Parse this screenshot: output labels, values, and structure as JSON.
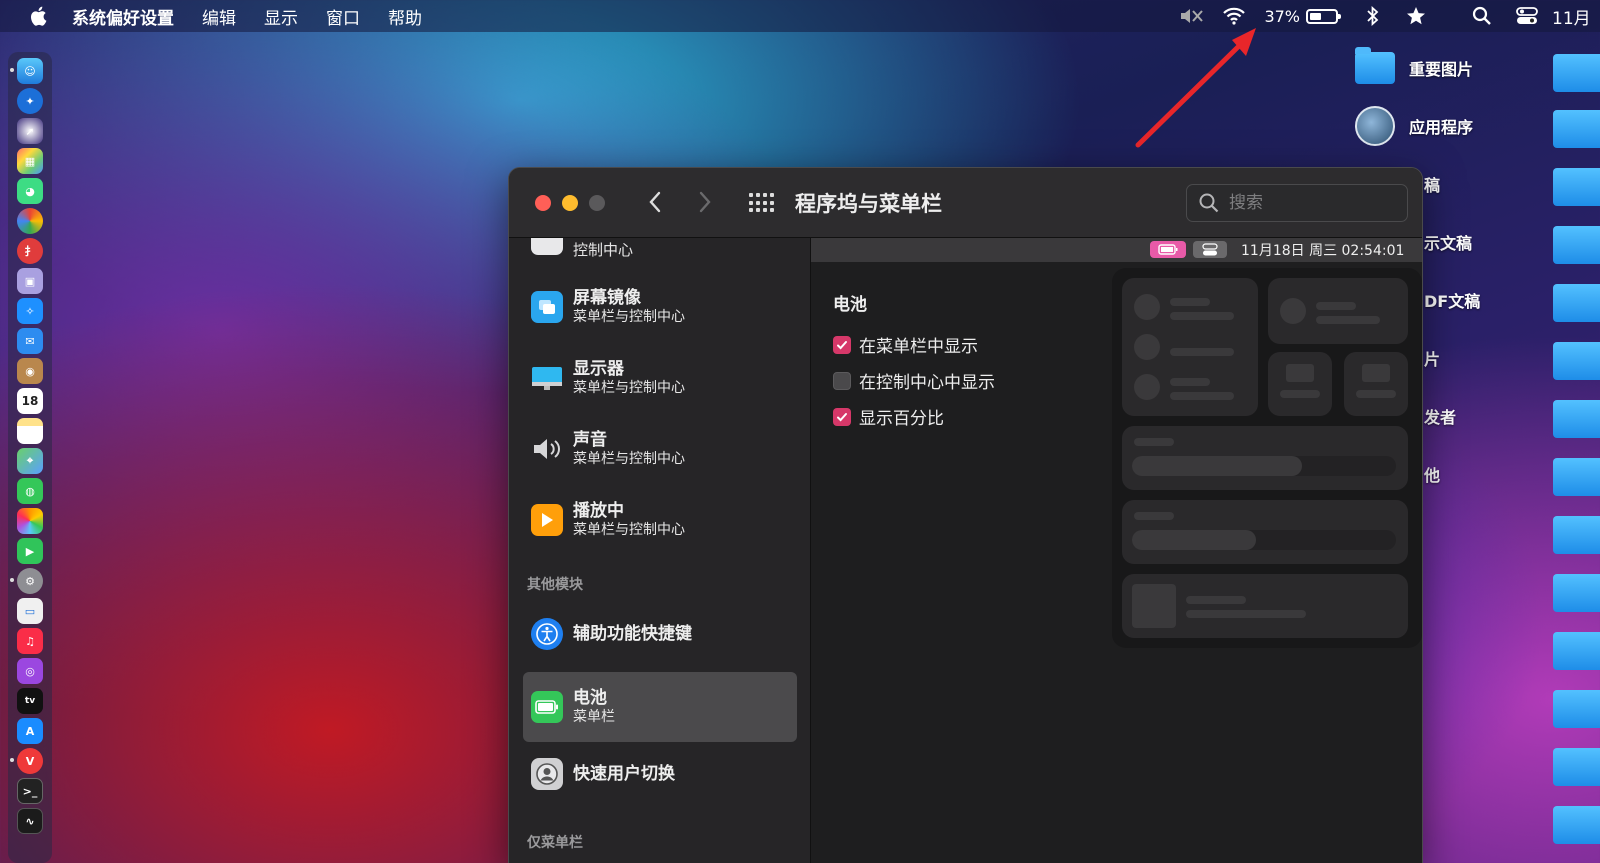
{
  "menubar": {
    "items": [
      "系统偏好设置",
      "编辑",
      "显示",
      "窗口",
      "帮助"
    ],
    "battery_percent": "37%",
    "date_partial": "11月"
  },
  "desktop": {
    "items": [
      "重要图片",
      "应用程序",
      "稿",
      "示文稿",
      "DF文稿",
      "片",
      "发者",
      "他"
    ]
  },
  "dock": {
    "calendar_day": "18",
    "tv_label": "tv"
  },
  "window": {
    "title": "程序坞与菜单栏",
    "search_placeholder": "搜索",
    "clock": "11月18日 周三 02:54:01"
  },
  "sidebar": {
    "partial_item": "控制中心",
    "items": [
      {
        "title": "屏幕镜像",
        "sub": "菜单栏与控制中心"
      },
      {
        "title": "显示器",
        "sub": "菜单栏与控制中心"
      },
      {
        "title": "声音",
        "sub": "菜单栏与控制中心"
      },
      {
        "title": "播放中",
        "sub": "菜单栏与控制中心"
      }
    ],
    "section_other": "其他模块",
    "other_items": [
      {
        "title": "辅助功能快捷键"
      },
      {
        "title": "电池",
        "sub": "菜单栏",
        "selected": true
      },
      {
        "title": "快速用户切换"
      }
    ],
    "section_menubar_only": "仅菜单栏"
  },
  "content": {
    "heading": "电池",
    "options": [
      {
        "label": "在菜单栏中显示",
        "checked": true
      },
      {
        "label": "在控制中心中显示",
        "checked": false
      },
      {
        "label": "显示百分比",
        "checked": true
      }
    ]
  },
  "colors": {
    "accent": "#d63869",
    "window_bg": "#1e1e1f",
    "sidebar_bg": "#262527",
    "arrow": "#e8262a"
  }
}
